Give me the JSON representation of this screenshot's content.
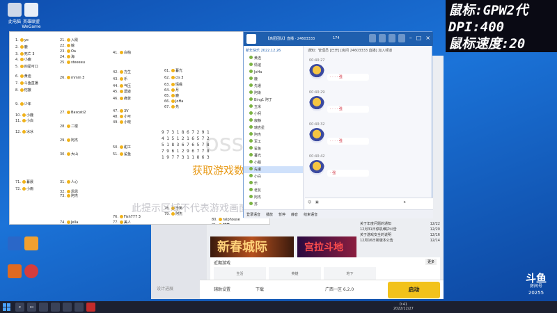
{
  "overlay": {
    "line1": "鼠标:GPW2代",
    "line2": "DPI:400",
    "line3": "鼠标速度:20"
  },
  "desktop_icons": [
    {
      "label": "此电脑"
    },
    {
      "label": "英雄联盟WeGame"
    }
  ],
  "list_items": [
    {
      "num": "1.",
      "text": "yo"
    },
    {
      "num": "2.",
      "text": "鹿"
    },
    {
      "num": "3.",
      "text": "死亡 3"
    },
    {
      "num": "4.",
      "text": "小鹿"
    },
    {
      "num": "5.",
      "text": "四星可口"
    },
    {
      "num": "6.",
      "text": "黄迪"
    },
    {
      "num": "7.",
      "text": "斗鱼直播"
    },
    {
      "num": "8.",
      "text": "恺撒"
    },
    {
      "num": "9.",
      "text": "少年"
    },
    {
      "num": "10.",
      "text": "小鹿"
    },
    {
      "num": "11.",
      "text": "小白"
    },
    {
      "num": "12.",
      "text": "冰冰"
    },
    {
      "num": "21.",
      "text": "入殿"
    },
    {
      "num": "22.",
      "text": "鲸"
    },
    {
      "num": "23.",
      "text": "Oa"
    },
    {
      "num": "24.",
      "text": "海"
    },
    {
      "num": "25.",
      "text": "steeeeu"
    },
    {
      "num": "26.",
      "text": "mmm 3"
    },
    {
      "num": "27.",
      "text": "Bascati2"
    },
    {
      "num": "28.",
      "text": "二楼"
    },
    {
      "num": "29.",
      "text": "阿杰"
    },
    {
      "num": "30.",
      "text": "大山"
    },
    {
      "num": "31.",
      "text": "人心"
    },
    {
      "num": "32.",
      "text": "恩恩"
    },
    {
      "num": "41.",
      "text": "白柏"
    },
    {
      "num": "42.",
      "text": "方生"
    },
    {
      "num": "43.",
      "text": "乐"
    },
    {
      "num": "44.",
      "text": "气压"
    },
    {
      "num": "45.",
      "text": "遗迹"
    },
    {
      "num": "46.",
      "text": "痛苦"
    },
    {
      "num": "47.",
      "text": "3V"
    },
    {
      "num": "48.",
      "text": "小可"
    },
    {
      "num": "49.",
      "text": "小晓"
    },
    {
      "num": "50.",
      "text": "甜工"
    },
    {
      "num": "51.",
      "text": "鲨鱼"
    },
    {
      "num": "61.",
      "text": "暮光"
    },
    {
      "num": "62.",
      "text": "cls 3"
    },
    {
      "num": "63.",
      "text": "情缘"
    },
    {
      "num": "64.",
      "text": "月"
    },
    {
      "num": "65.",
      "text": "鹿"
    },
    {
      "num": "66.",
      "text": "JoHa"
    },
    {
      "num": "67.",
      "text": "先"
    },
    {
      "num": "71.",
      "text": "暮晨"
    },
    {
      "num": "72.",
      "text": "小雨"
    },
    {
      "num": "73.",
      "text": "阿杰"
    },
    {
      "num": "74.",
      "text": "Jella"
    },
    {
      "num": "75.",
      "text": "小鱼"
    },
    {
      "num": "76.",
      "text": "Fish777 3"
    },
    {
      "num": "77.",
      "text": "美人"
    },
    {
      "num": "78.",
      "text": "千笑"
    },
    {
      "num": "79.",
      "text": "阿杰"
    },
    {
      "num": "80.",
      "text": "ralphouse"
    },
    {
      "num": "81.",
      "text": "楚楚"
    }
  ],
  "number_grid": [
    "9 7 3 1 8 6 7 2 9 1",
    "4 1 5 1 2 1 6 5 7 2",
    "5 1 8 3 6 7 6 5 7 8",
    "7 9 6 1 2 9 6 7 7 8",
    "1 9 7 7 3 1 1 8 6 3"
  ],
  "loading_text": "获取游戏数据中",
  "watermark_text": "此提示区域不代表游戏画面",
  "big_watermark": "ossf",
  "chat": {
    "title": "【高团团队】直播 · 24603333",
    "count": "174",
    "tree_header": "新年快乐 2022.12.26",
    "system_msg": "通知：管理员 [已开] [房间 24603333 直播] 加入频道",
    "messages": [
      {
        "time": "00:40:27",
        "bubble": "· · · · 强"
      },
      {
        "time": "00:40:29",
        "bubble": "· · · · 强"
      },
      {
        "time": "00:40:32",
        "bubble": "· · · · 强"
      },
      {
        "time": "00:40:42",
        "bubble": "· 强"
      }
    ],
    "tree_nodes": [
      "黄连",
      "情谊",
      "JoHa",
      "鹿",
      "先遣",
      "阿柒",
      "Bing1 阿丁",
      "玉米",
      "小柯",
      "寂静",
      "瑞吉星",
      "阿杰",
      "军工",
      "鲨鱼",
      "暮光",
      "小甜",
      "先遣",
      "小白",
      "乐",
      "老友",
      "阿杰",
      "苏"
    ],
    "footer": [
      "登录语音",
      "播放",
      "暂停",
      "静音",
      "结束语音"
    ]
  },
  "client": {
    "banner1": "新春城际",
    "banner2": "宫拉斗地",
    "recent_label": "近期游戏",
    "more_label": "更多",
    "recent_cards": [
      "生活",
      "英雄",
      "地下"
    ],
    "news": [
      {
        "text": "关于年度问题的通知",
        "date": "12/22"
      },
      {
        "text": "12月31日停机维护公告",
        "date": "12/20"
      },
      {
        "text": "关于游戏安全的说明",
        "date": "12/16"
      },
      {
        "text": "12月16日新版本公告",
        "date": "12/14"
      }
    ],
    "bottom_settings": "辅助设置",
    "bottom_download": "下载",
    "server": "广西一区 6.2.0",
    "start_label": "启动",
    "nav_label": "设计进展"
  },
  "taskbar": {
    "time": "0:41",
    "date": "2022/12/27"
  },
  "douyu": {
    "logo": "斗鱼",
    "sub": "房间号",
    "room": "20255"
  }
}
